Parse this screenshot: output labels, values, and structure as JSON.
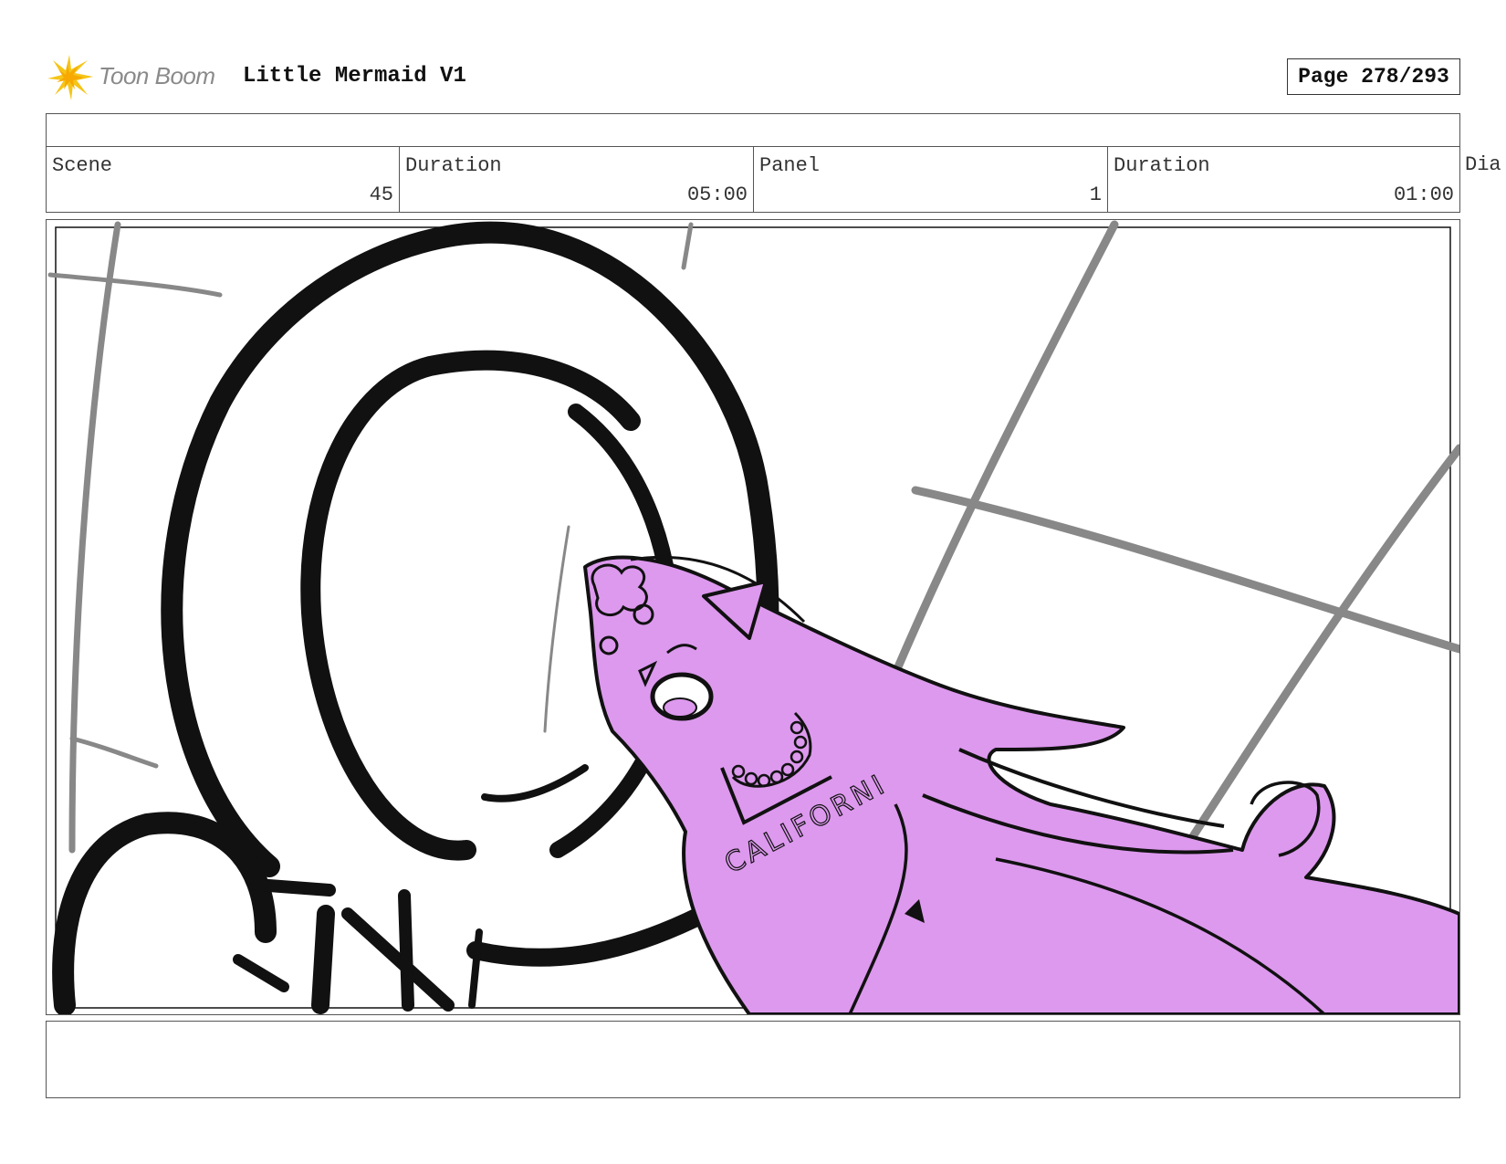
{
  "header": {
    "logo_text": "Toon Boom",
    "project_title": "Little Mermaid V1",
    "page_label": "Page 278/293"
  },
  "info": {
    "scene_label": "Scene",
    "scene_value": "45",
    "scene_duration_label": "Duration",
    "scene_duration_value": "05:00",
    "panel_label": "Panel",
    "panel_value": "1",
    "panel_duration_label": "Duration",
    "panel_duration_value": "01:00",
    "dialogue_label_partial": "Dia"
  },
  "panel": {
    "shirt_text": "CALIFORNI",
    "character_fill_color": "#dd99ee",
    "line_color": "#111111",
    "guide_line_color": "#888888"
  },
  "notes": {
    "text": ""
  }
}
